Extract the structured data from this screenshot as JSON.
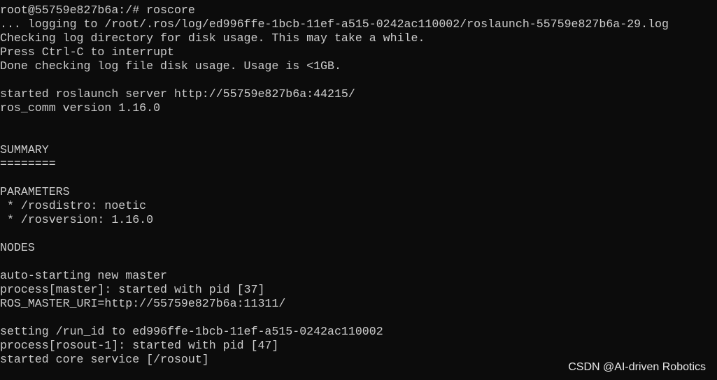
{
  "terminal": {
    "lines": [
      "root@55759e827b6a:/# roscore",
      "... logging to /root/.ros/log/ed996ffe-1bcb-11ef-a515-0242ac110002/roslaunch-55759e827b6a-29.log",
      "Checking log directory for disk usage. This may take a while.",
      "Press Ctrl-C to interrupt",
      "Done checking log file disk usage. Usage is <1GB.",
      "",
      "started roslaunch server http://55759e827b6a:44215/",
      "ros_comm version 1.16.0",
      "",
      "",
      "SUMMARY",
      "========",
      "",
      "PARAMETERS",
      " * /rosdistro: noetic",
      " * /rosversion: 1.16.0",
      "",
      "NODES",
      "",
      "auto-starting new master",
      "process[master]: started with pid [37]",
      "ROS_MASTER_URI=http://55759e827b6a:11311/",
      "",
      "setting /run_id to ed996ffe-1bcb-11ef-a515-0242ac110002",
      "process[rosout-1]: started with pid [47]",
      "started core service [/rosout]"
    ]
  },
  "watermark": "CSDN @AI-driven Robotics",
  "colors": {
    "background": "#0c0c0c",
    "text": "#cccccc"
  }
}
